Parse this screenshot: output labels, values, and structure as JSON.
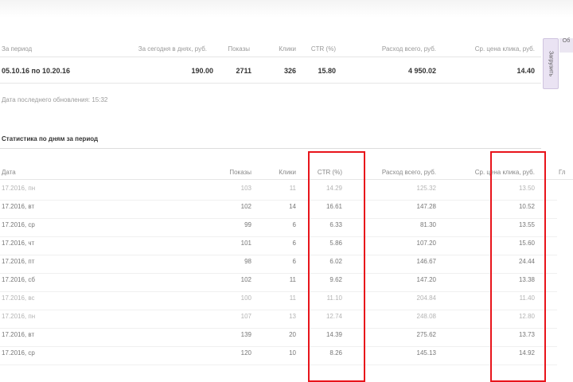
{
  "summary": {
    "headers": [
      "За период",
      "За сегодня в днях, руб.",
      "Показы",
      "Клики",
      "CTR (%)",
      "Расход всего, руб.",
      "Ср. цена клика, руб."
    ],
    "row": [
      "05.10.16 по 10.20.16",
      "190.00",
      "2711",
      "326",
      "15.80",
      "4 950.02",
      "14.40"
    ],
    "side_button": "Загрузить",
    "right_clip": "Об"
  },
  "note": "Дата последнего обновления: 15:32",
  "daily": {
    "title": "Статистика по дням за период",
    "headers": [
      "Дата",
      "Показы",
      "Клики",
      "CTR (%)",
      "Расход всего, руб.",
      "Ср. цена клика, руб.",
      "Гл"
    ],
    "rows": [
      {
        "date": "17.2016, пн",
        "shows": "103",
        "clicks": "11",
        "ctr": "14.29",
        "spend": "125.32",
        "cpc": "13.50",
        "muted": true
      },
      {
        "date": "17.2016, вт",
        "shows": "102",
        "clicks": "14",
        "ctr": "16.61",
        "spend": "147.28",
        "cpc": "10.52",
        "muted": false
      },
      {
        "date": "17.2016, ср",
        "shows": "99",
        "clicks": "6",
        "ctr": "6.33",
        "spend": "81.30",
        "cpc": "13.55",
        "muted": false
      },
      {
        "date": "17.2016, чт",
        "shows": "101",
        "clicks": "6",
        "ctr": "5.86",
        "spend": "107.20",
        "cpc": "15.60",
        "muted": false
      },
      {
        "date": "17.2016, пт",
        "shows": "98",
        "clicks": "6",
        "ctr": "6.02",
        "spend": "146.67",
        "cpc": "24.44",
        "muted": false
      },
      {
        "date": "17.2016, сб",
        "shows": "102",
        "clicks": "11",
        "ctr": "9.62",
        "spend": "147.20",
        "cpc": "13.38",
        "muted": false
      },
      {
        "date": "17.2016, вс",
        "shows": "100",
        "clicks": "11",
        "ctr": "11.10",
        "spend": "204.84",
        "cpc": "11.40",
        "muted": true
      },
      {
        "date": "17.2016, пн",
        "shows": "107",
        "clicks": "13",
        "ctr": "12.74",
        "spend": "248.08",
        "cpc": "12.80",
        "muted": true
      },
      {
        "date": "17.2016, вт",
        "shows": "139",
        "clicks": "20",
        "ctr": "14.39",
        "spend": "275.62",
        "cpc": "13.73",
        "muted": false
      },
      {
        "date": "17.2016, ср",
        "shows": "120",
        "clicks": "10",
        "ctr": "8.26",
        "spend": "145.13",
        "cpc": "14.92",
        "muted": false
      }
    ]
  },
  "colors": {
    "highlight": "#e8141b",
    "side_button_bg": "#eae3f3"
  }
}
